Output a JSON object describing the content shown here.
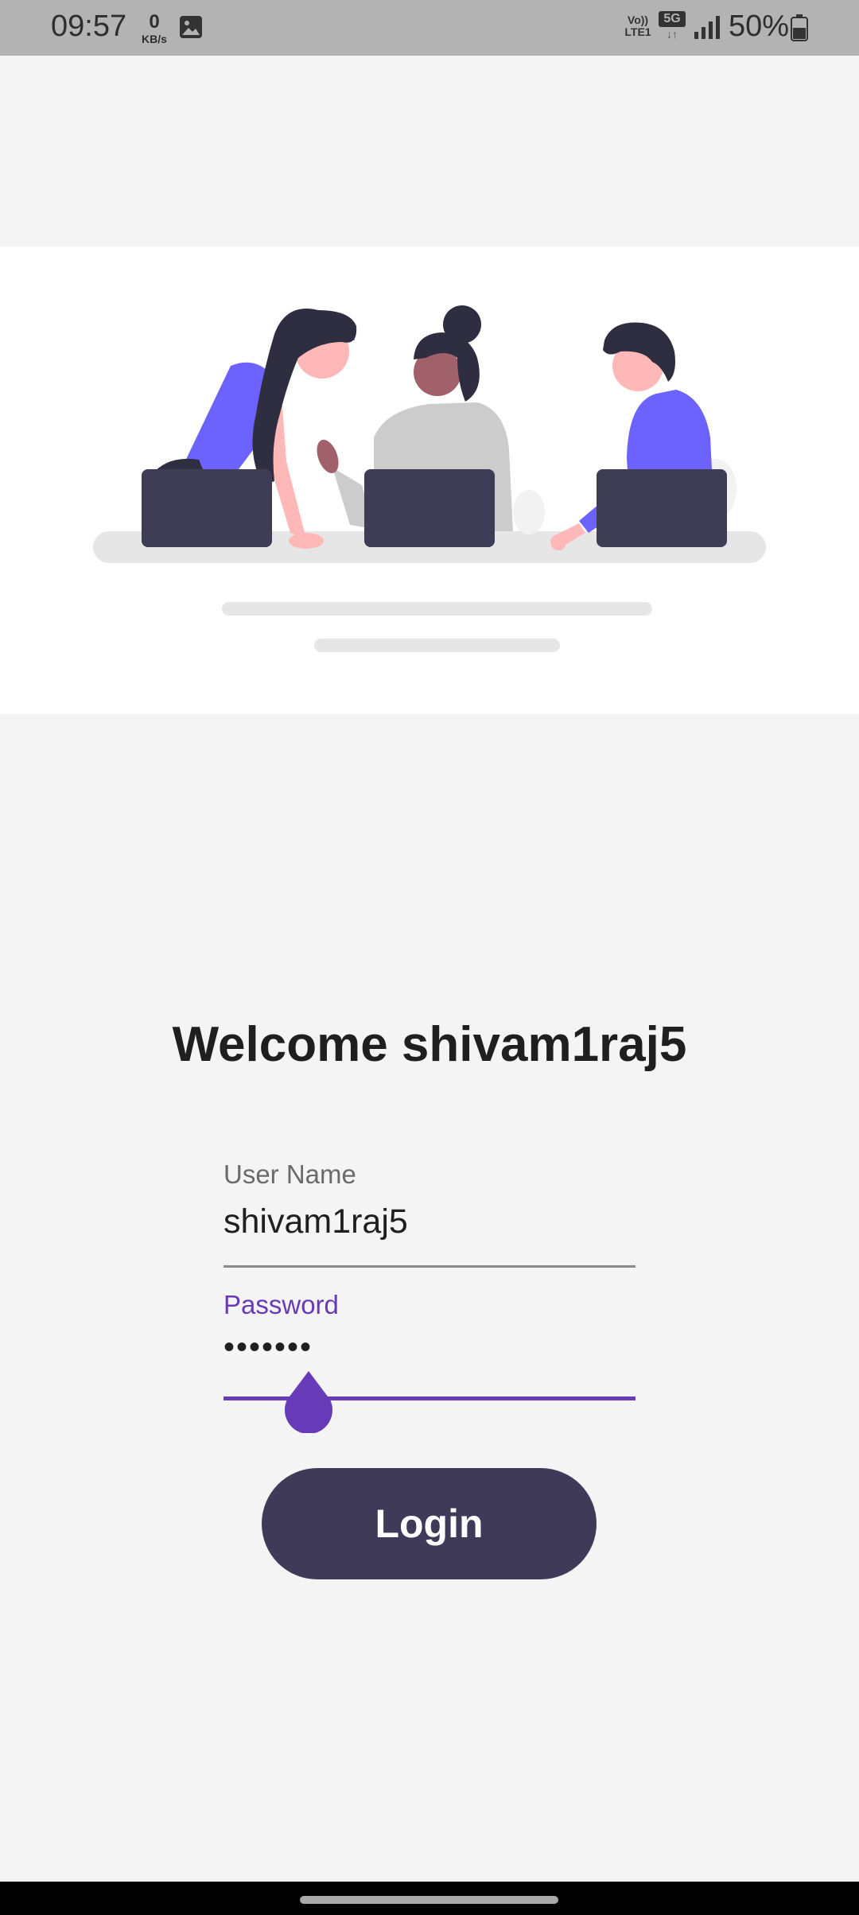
{
  "status_bar": {
    "time": "09:57",
    "net_speed": "0",
    "net_unit": "KB/s",
    "volte_line1": "Vo))",
    "volte_line2": "LTE1",
    "network_type": "5G",
    "network_arrows": "↓↑",
    "battery": "50%",
    "icons": [
      "image-icon",
      "signal-icon",
      "battery-icon"
    ]
  },
  "hero": {
    "illustration": "people-working-laptops-illustration",
    "colors": {
      "accent": "#6c63ff",
      "dark": "#3f3d56",
      "hair": "#2f2e41",
      "skin": "#ffb8b8",
      "skin_dark": "#a0616a",
      "gray": "#e6e6e6"
    }
  },
  "login": {
    "welcome": "Welcome shivam1raj5",
    "username_label": "User Name",
    "username_value": "shivam1raj5",
    "password_label": "Password",
    "password_value": "•••••••",
    "login_button": "Login",
    "accent_color": "#673ab7",
    "button_color": "#3f3a58"
  }
}
